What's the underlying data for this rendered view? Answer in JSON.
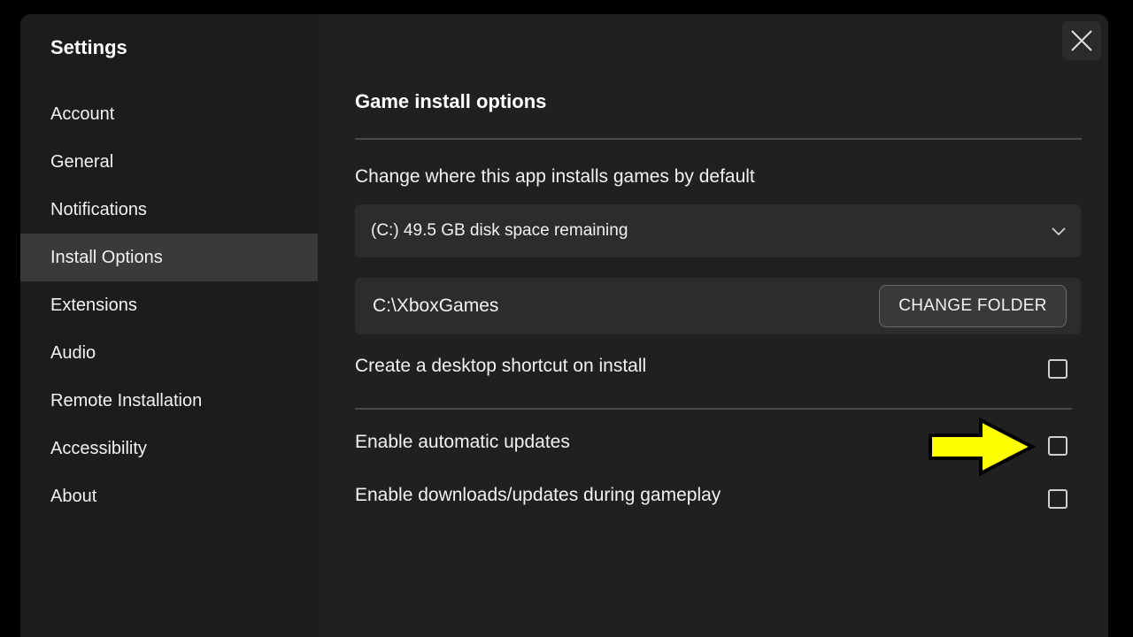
{
  "sidebar": {
    "title": "Settings",
    "items": [
      {
        "label": "Account",
        "active": false
      },
      {
        "label": "General",
        "active": false
      },
      {
        "label": "Notifications",
        "active": false
      },
      {
        "label": "Install Options",
        "active": true
      },
      {
        "label": "Extensions",
        "active": false
      },
      {
        "label": "Audio",
        "active": false
      },
      {
        "label": "Remote Installation",
        "active": false
      },
      {
        "label": "Accessibility",
        "active": false
      },
      {
        "label": "About",
        "active": false
      }
    ]
  },
  "main": {
    "section_title": "Game install options",
    "install_location_label": "Change where this app installs games by default",
    "drive_dropdown": {
      "selected": "(C:) 49.5 GB disk space remaining"
    },
    "install_path": "C:\\XboxGames",
    "change_folder_label": "CHANGE FOLDER",
    "options": [
      {
        "label": "Create a desktop shortcut on install",
        "checked": false
      },
      {
        "label": "Enable automatic updates",
        "checked": false
      },
      {
        "label": "Enable downloads/updates during gameplay",
        "checked": false
      }
    ]
  },
  "icons": {
    "close": "close-icon",
    "dropdown": "chevron-down-icon",
    "annotation": "arrow-right-icon"
  },
  "colors": {
    "background": "#000000",
    "sidebar": "#1c1c1c",
    "panel": "#202020",
    "active_item": "#3a3a3a",
    "annotation_arrow": "#ffff00"
  }
}
